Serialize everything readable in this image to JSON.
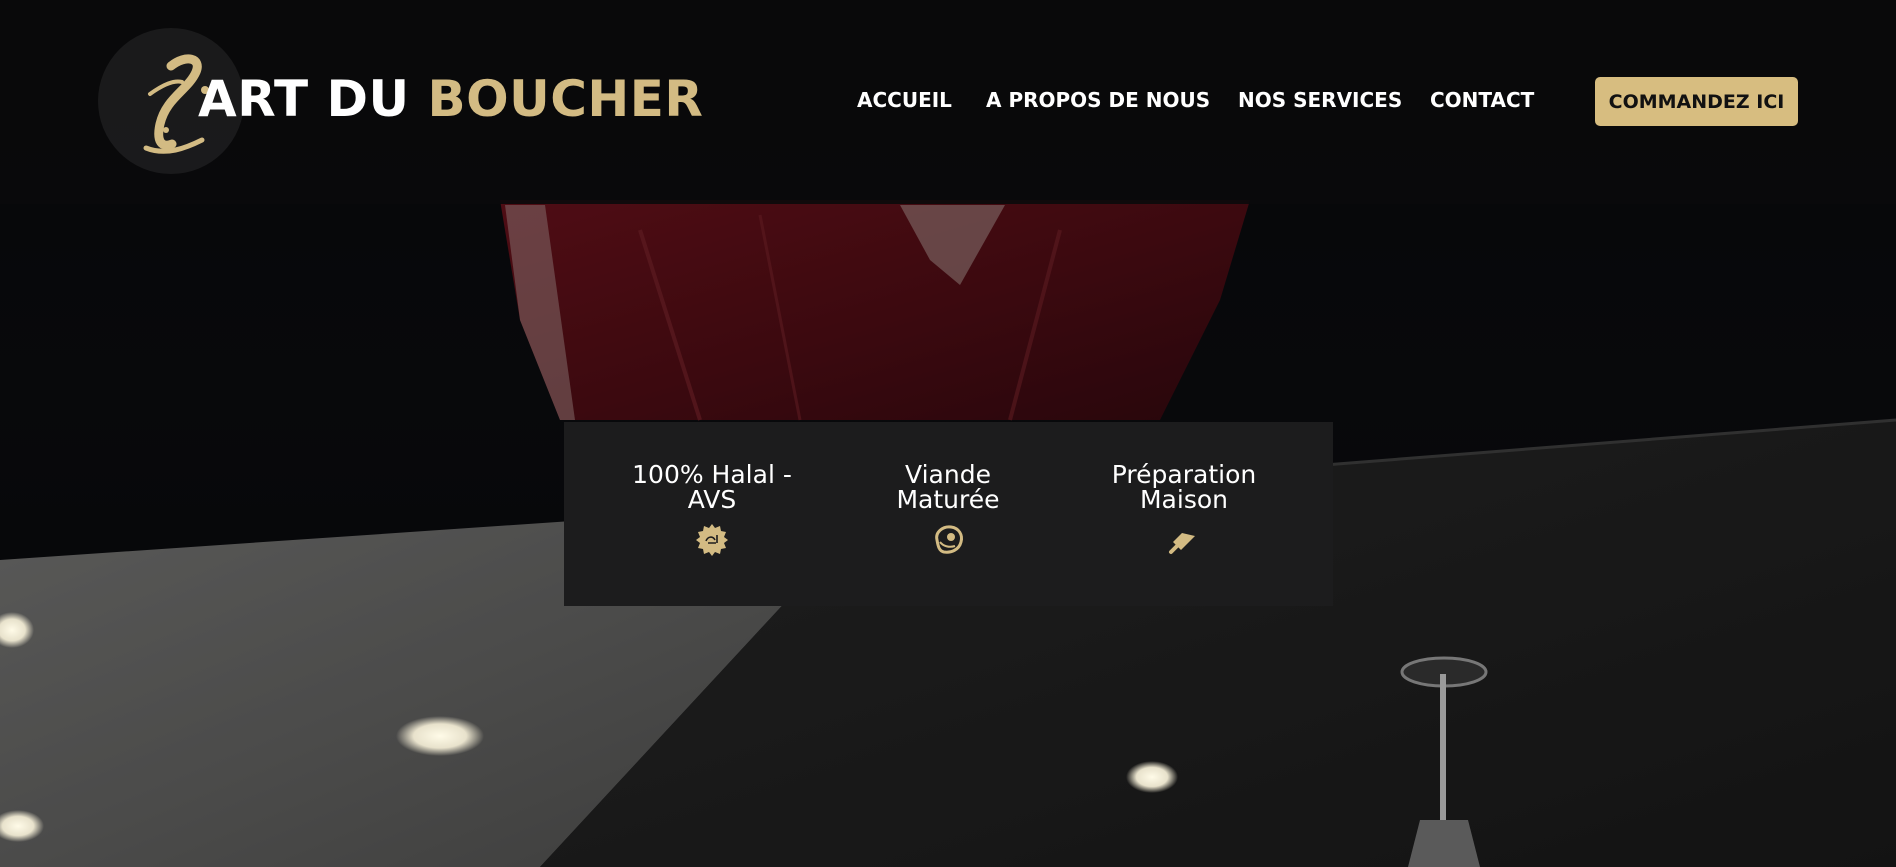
{
  "brand": {
    "logo_letter": "L",
    "name_white": "ART DU",
    "name_gold": "BOUCHER",
    "accent_color": "#d3bb83"
  },
  "nav": {
    "items": [
      {
        "label": "ACCUEIL"
      },
      {
        "label": "A PROPOS DE NOUS"
      },
      {
        "label": "NOS SERVICES"
      },
      {
        "label": "CONTACT"
      }
    ],
    "cta_label": "COMMANDEZ ICI",
    "cta_color": "#d7bd80"
  },
  "features": [
    {
      "line1": "100% Halal -",
      "line2": "AVS",
      "icon": "halal-seal-icon"
    },
    {
      "line1": "Viande",
      "line2": "Maturée",
      "icon": "meat-icon"
    },
    {
      "line1": "Préparation",
      "line2": "Maison",
      "icon": "cleaver-icon"
    }
  ]
}
